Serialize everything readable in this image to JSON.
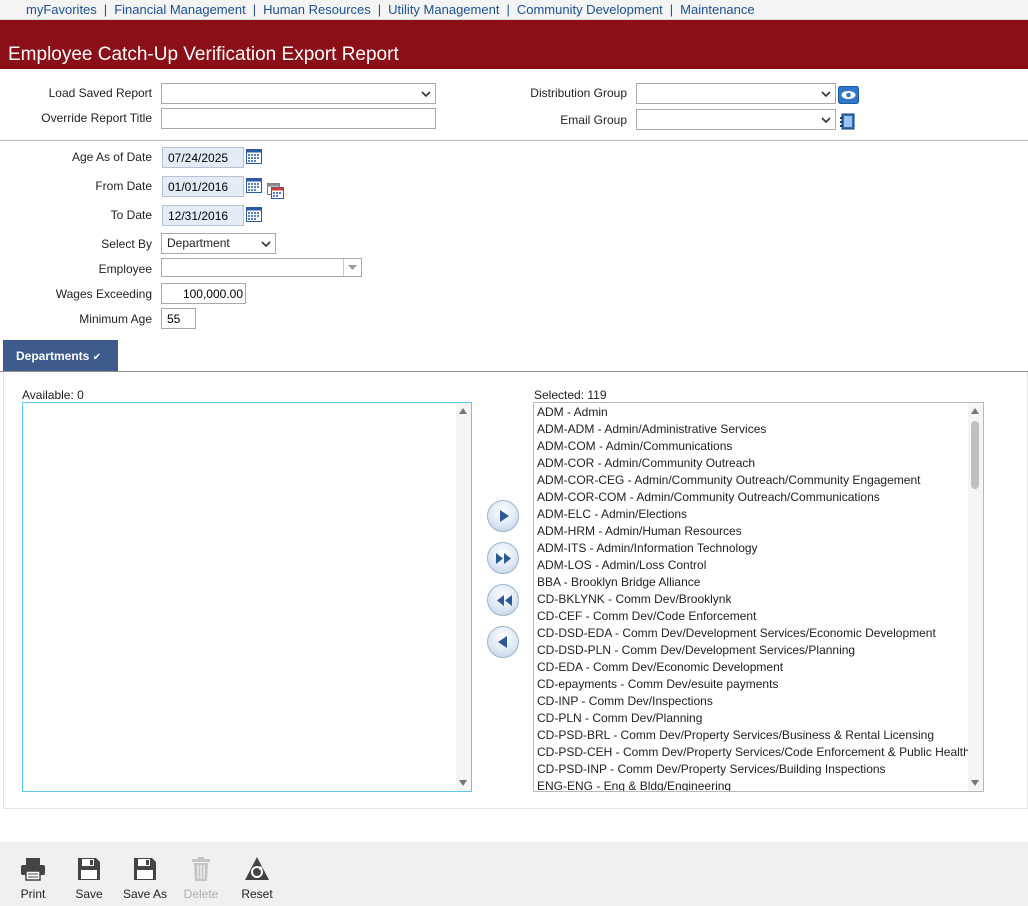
{
  "topnav": {
    "items": [
      "myFavorites",
      "Financial Management",
      "Human Resources",
      "Utility Management",
      "Community Development",
      "Maintenance"
    ]
  },
  "title": "Employee Catch-Up Verification Export Report",
  "form": {
    "load_saved_report": {
      "label": "Load Saved Report",
      "value": ""
    },
    "override_report_title": {
      "label": "Override Report Title",
      "value": ""
    },
    "distribution_group": {
      "label": "Distribution Group",
      "value": ""
    },
    "email_group": {
      "label": "Email Group",
      "value": ""
    },
    "age_as_of_date": {
      "label": "Age As of Date",
      "value": "07/24/2025"
    },
    "from_date": {
      "label": "From Date",
      "value": "01/01/2016"
    },
    "to_date": {
      "label": "To Date",
      "value": "12/31/2016"
    },
    "select_by": {
      "label": "Select By",
      "value": "Department"
    },
    "employee": {
      "label": "Employee",
      "value": ""
    },
    "wages_exceeding": {
      "label": "Wages Exceeding",
      "value": "100,000.00"
    },
    "minimum_age": {
      "label": "Minimum Age",
      "value": "55"
    }
  },
  "tabs": {
    "departments": "Departments",
    "check": "✔"
  },
  "available": {
    "label": "Available: 0",
    "items": []
  },
  "selected": {
    "label": "Selected: 119",
    "items": [
      "ADM - Admin",
      "ADM-ADM - Admin/Administrative Services",
      "ADM-COM - Admin/Communications",
      "ADM-COR - Admin/Community Outreach",
      "ADM-COR-CEG - Admin/Community Outreach/Community Engagement",
      "ADM-COR-COM - Admin/Community Outreach/Communications",
      "ADM-ELC - Admin/Elections",
      "ADM-HRM - Admin/Human Resources",
      "ADM-ITS - Admin/Information Technology",
      "ADM-LOS - Admin/Loss Control",
      "BBA - Brooklyn Bridge Alliance",
      "CD-BKLYNK - Comm Dev/Brooklynk",
      "CD-CEF - Comm Dev/Code Enforcement",
      "CD-DSD-EDA - Comm Dev/Development Services/Economic Development",
      "CD-DSD-PLN - Comm Dev/Development Services/Planning",
      "CD-EDA - Comm Dev/Economic Development",
      "CD-epayments - Comm Dev/esuite payments",
      "CD-INP - Comm Dev/Inspections",
      "CD-PLN - Comm Dev/Planning",
      "CD-PSD-BRL - Comm Dev/Property Services/Business & Rental Licensing",
      "CD-PSD-CEH - Comm Dev/Property Services/Code Enforcement & Public Health",
      "CD-PSD-INP - Comm Dev/Property Services/Building Inspections",
      "ENG-ENG - Eng & Bldg/Engineering"
    ]
  },
  "toolbar": {
    "print": "Print",
    "save": "Save",
    "save_as": "Save As",
    "delete": "Delete",
    "reset": "Reset"
  },
  "colors": {
    "title_bar": "#8b0f17",
    "tab": "#3d5c8c",
    "nav_link": "#1c4f93"
  }
}
